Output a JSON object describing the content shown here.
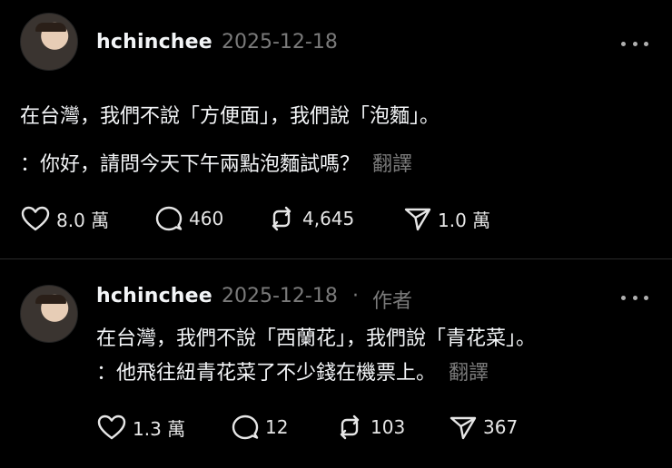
{
  "posts": [
    {
      "username": "hchinchee",
      "date": "2025-12-18",
      "author_badge": "",
      "line1": "在台灣，我們不說「方便面」，我們說「泡麵」。",
      "line2": "：你好，請問今天下午兩點泡麵試嗎？",
      "translate": "翻譯",
      "likes": "8.0 萬",
      "comments": "460",
      "reposts": "4,645",
      "shares": "1.0 萬"
    },
    {
      "username": "hchinchee",
      "date": "2025-12-18",
      "separator": "·",
      "author_badge": "作者",
      "line1": "在台灣，我們不說「西蘭花」，我們說「青花菜」。",
      "line2": "：他飛往紐青花菜了不少錢在機票上。",
      "translate": "翻譯",
      "likes": "1.3 萬",
      "comments": "12",
      "reposts": "103",
      "shares": "367"
    }
  ],
  "icons": [
    "heart-icon",
    "comment-icon",
    "repost-icon",
    "share-icon",
    "more-icon"
  ],
  "colors": {
    "background": "#000000",
    "text": "#f3f5f7",
    "muted": "#7a7a7a"
  }
}
